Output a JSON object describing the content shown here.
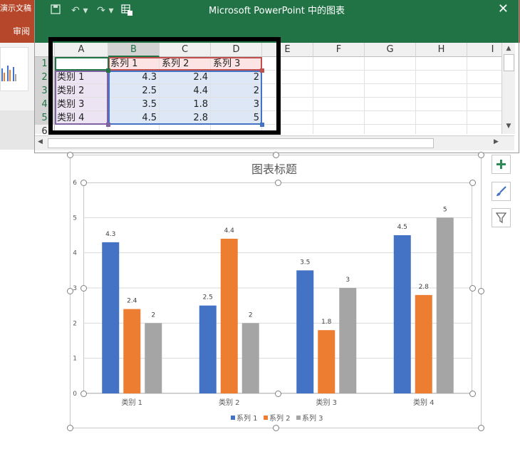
{
  "ppt": {
    "doc_title": "演示文稿",
    "tab_review": "审阅"
  },
  "excel": {
    "window_title": "Microsoft PowerPoint 中的图表",
    "columns": [
      "A",
      "B",
      "C",
      "D",
      "E",
      "F",
      "G",
      "H",
      "I"
    ],
    "rows": [
      "1",
      "2",
      "3",
      "4",
      "5",
      "6"
    ],
    "header_row": [
      "",
      "系列 1",
      "系列 2",
      "系列 3"
    ],
    "data_rows": [
      [
        "类别 1",
        "4.3",
        "2.4",
        "2"
      ],
      [
        "类别 2",
        "2.5",
        "4.4",
        "2"
      ],
      [
        "类别 3",
        "3.5",
        "1.8",
        "3"
      ],
      [
        "类别 4",
        "4.5",
        "2.8",
        "5"
      ]
    ]
  },
  "chart_data": {
    "type": "bar",
    "title": "图表标题",
    "categories": [
      "类别 1",
      "类别 2",
      "类别 3",
      "类别 4"
    ],
    "series": [
      {
        "name": "系列 1",
        "values": [
          4.3,
          2.5,
          3.5,
          4.5
        ],
        "color": "#4472c4"
      },
      {
        "name": "系列 2",
        "values": [
          2.4,
          4.4,
          1.8,
          2.8
        ],
        "color": "#ed7d31"
      },
      {
        "name": "系列 3",
        "values": [
          2,
          2,
          3,
          5
        ],
        "color": "#a5a5a5"
      }
    ],
    "ylim": [
      0,
      6
    ],
    "yticks": [
      "0",
      "1",
      "2",
      "3",
      "4",
      "5",
      "6"
    ],
    "grid": true,
    "legend": "bottom"
  },
  "colors": {
    "excel_green": "#217346",
    "ppt_red": "#b7472a"
  }
}
